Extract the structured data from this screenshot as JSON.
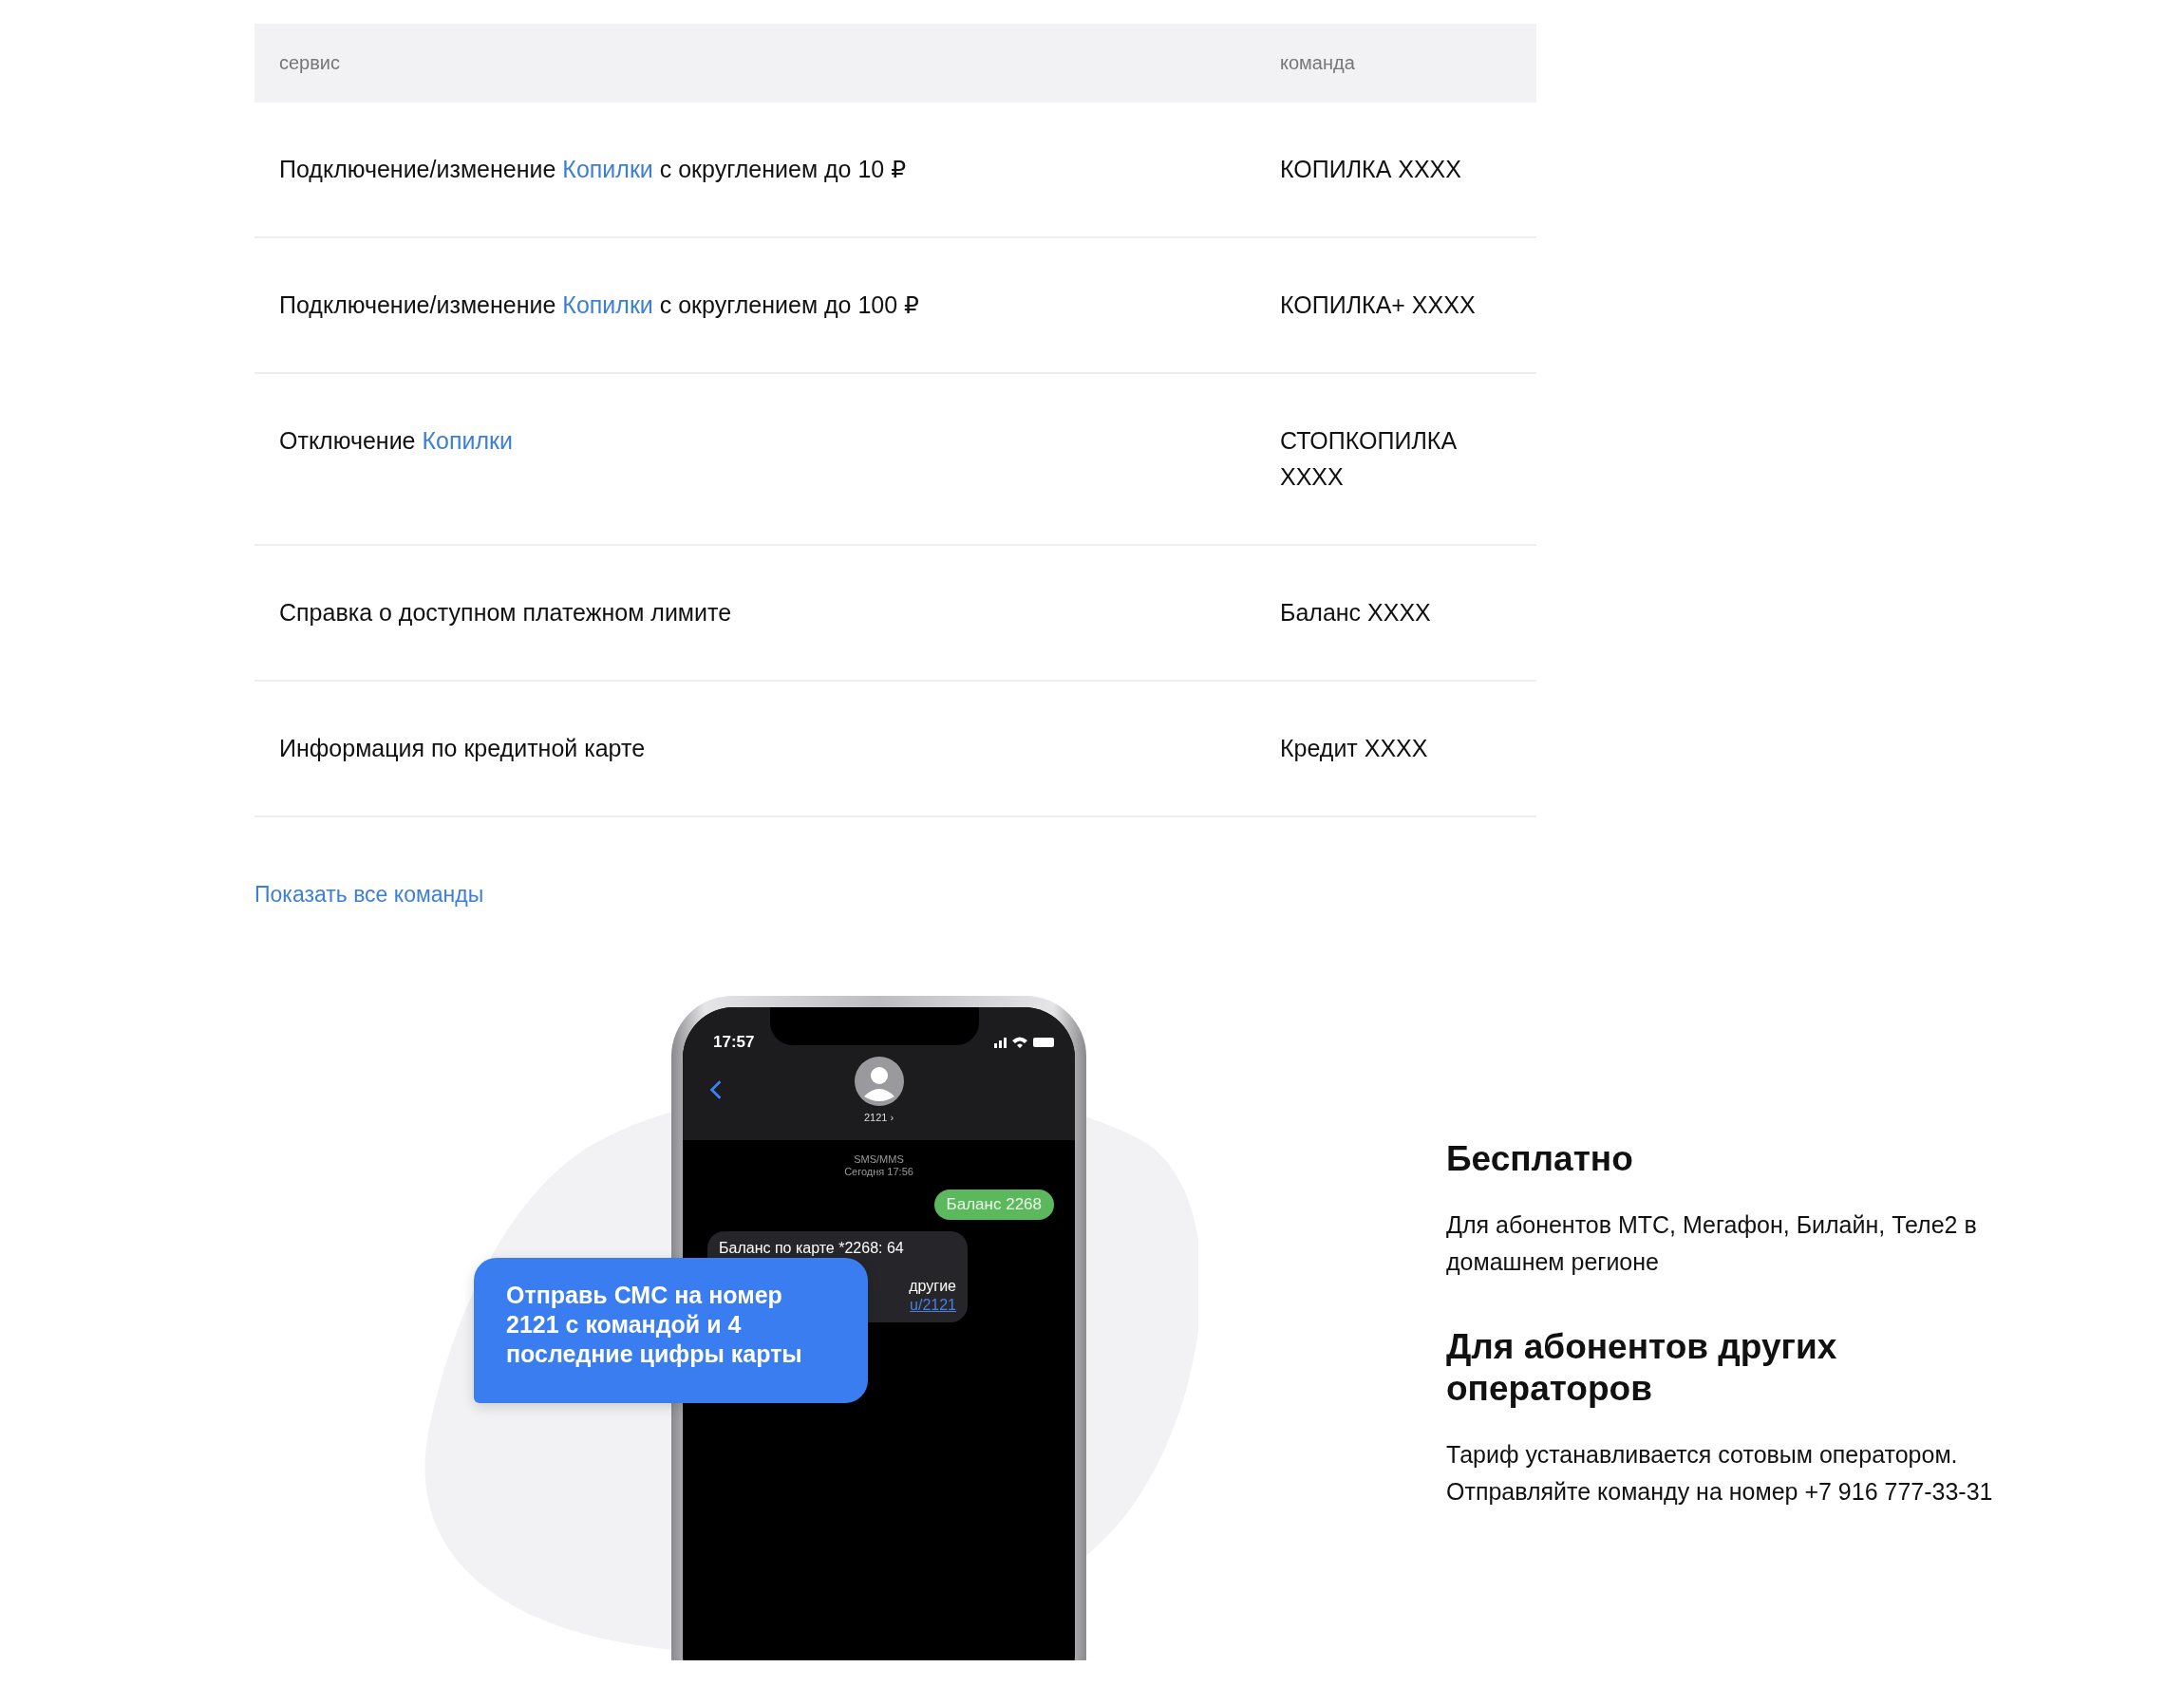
{
  "table": {
    "columns": [
      "сервис",
      "команда"
    ],
    "rows": [
      {
        "service": [
          {
            "text": "Подключение/изменение "
          },
          {
            "text": "Копилки",
            "link": true
          },
          {
            "text": " с округлением до 10 ₽"
          }
        ],
        "command": "КОПИЛКА XXXX"
      },
      {
        "service": [
          {
            "text": "Подключение/изменение "
          },
          {
            "text": "Копилки",
            "link": true
          },
          {
            "text": " с округлением до 100 ₽"
          }
        ],
        "command": "КОПИЛКА+ XXXX"
      },
      {
        "service": [
          {
            "text": "Отключение "
          },
          {
            "text": "Копилки",
            "link": true
          }
        ],
        "command": "СТОПКОПИЛКА XXXX"
      },
      {
        "service": [
          {
            "text": "Справка о доступном платежном лимите"
          }
        ],
        "command": "Баланс XXXX"
      },
      {
        "service": [
          {
            "text": "Информация по кредитной карте"
          }
        ],
        "command": "Кредит XXXX"
      }
    ]
  },
  "show_all_link": "Показать все команды",
  "phone": {
    "time": "17:57",
    "contact": "2121 ›",
    "channel": "SMS/MMS",
    "date": "Сегодня 17:56",
    "messages": [
      {
        "kind": "sent",
        "text": "Баланс 2268"
      },
      {
        "kind": "received",
        "lines": [
          {
            "text": "Баланс по карте *2268: 64"
          },
          {
            "text": "другие"
          },
          {
            "text": "u/2121",
            "link": true
          }
        ]
      }
    ]
  },
  "callout": "Отправь СМС на номер 2121 с командой и 4 последние цифры карты",
  "info": [
    {
      "title": "Бесплатно",
      "text": "Для абонентов МТС, Мегафон, Билайн, Теле2 в домашнем регионе"
    },
    {
      "title": "Для абонентов других операторов",
      "text": "Тариф устанавливается сотовым оператором. Отправляйте команду на номер +7 916 777-33-31"
    }
  ]
}
